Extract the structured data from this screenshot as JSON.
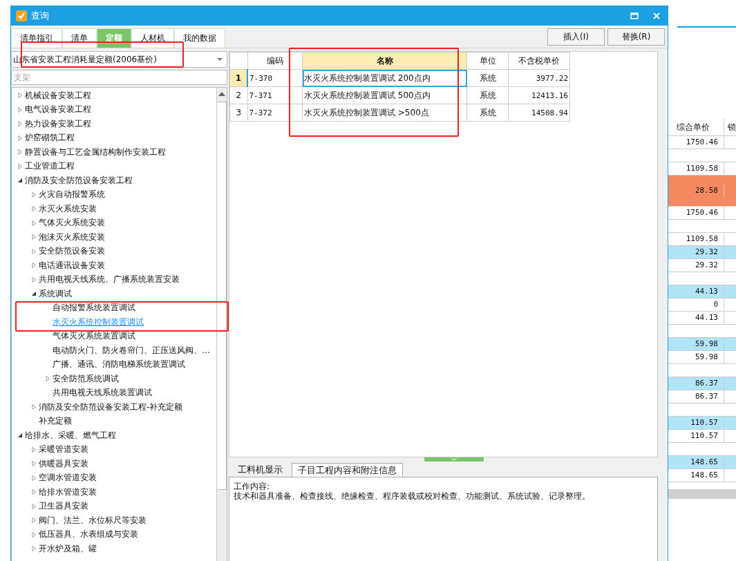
{
  "window": {
    "title": "查询"
  },
  "tabs": [
    {
      "label": "清单指引",
      "selected": false
    },
    {
      "label": "清单",
      "selected": false
    },
    {
      "label": "定额",
      "selected": true
    },
    {
      "label": "人材机",
      "selected": false
    },
    {
      "label": "我的数据",
      "selected": false
    }
  ],
  "buttons": [
    "插入(I)",
    "替换(R)"
  ],
  "library_select": {
    "value": "山东省安装工程消耗量定额(2006基价)"
  },
  "search": {
    "placeholder": "支架"
  },
  "tree": [
    {
      "label": "机械设备安装工程",
      "kind": "folder",
      "expanded": false,
      "selected": false
    },
    {
      "label": "电气设备安装工程",
      "kind": "folder",
      "expanded": false,
      "selected": false
    },
    {
      "label": "热力设备安装工程",
      "kind": "folder",
      "expanded": false,
      "selected": false
    },
    {
      "label": "炉窑砌筑工程",
      "kind": "folder",
      "expanded": false,
      "selected": false
    },
    {
      "label": "静置设备与工艺金属结构制作安装工程",
      "kind": "folder",
      "expanded": false,
      "selected": false
    },
    {
      "label": "工业管道工程",
      "kind": "folder",
      "expanded": false,
      "selected": false
    },
    {
      "label": "消防及安全防范设备安装工程",
      "kind": "folder",
      "expanded": true,
      "selected": false,
      "children": [
        {
          "label": "火灾自动报警系统",
          "kind": "folder",
          "expanded": false,
          "selected": false
        },
        {
          "label": "水灭火系统安装",
          "kind": "folder",
          "expanded": false,
          "selected": false
        },
        {
          "label": "气体灭火系统安装",
          "kind": "folder",
          "expanded": false,
          "selected": false
        },
        {
          "label": "泡沫灭火系统安装",
          "kind": "folder",
          "expanded": false,
          "selected": false
        },
        {
          "label": "安全防范设备安装",
          "kind": "folder",
          "expanded": false,
          "selected": false
        },
        {
          "label": "电话通讯设备安装",
          "kind": "folder",
          "expanded": false,
          "selected": false
        },
        {
          "label": "共用电视天线系统、广播系统装置安装",
          "kind": "folder",
          "expanded": false,
          "selected": false
        },
        {
          "label": "系统调试",
          "kind": "folder",
          "expanded": true,
          "selected": false,
          "children": [
            {
              "label": "自动报警系统装置调试",
              "kind": "leaf",
              "selected": false
            },
            {
              "label": "水灭火系统控制装置调试",
              "kind": "leaf",
              "selected": true
            },
            {
              "label": "气体灭火系统装置调试",
              "kind": "leaf",
              "selected": false
            },
            {
              "label": "电动防火门、防火卷帘门、正压送风阀、…",
              "kind": "leaf",
              "selected": false
            },
            {
              "label": "广播、通讯、消防电梯系统装置调试",
              "kind": "leaf",
              "selected": false
            },
            {
              "label": "安全防范系统调试",
              "kind": "folder",
              "expanded": false,
              "selected": false
            },
            {
              "label": "共用电视天线系统装置调试",
              "kind": "leaf",
              "selected": false
            }
          ]
        },
        {
          "label": "消防及安全防范设备安装工程-补充定额",
          "kind": "folder",
          "expanded": false,
          "selected": false
        },
        {
          "label": "补充定额",
          "kind": "leaf",
          "selected": false
        }
      ]
    },
    {
      "label": "给排水、采暖、燃气工程",
      "kind": "folder",
      "expanded": true,
      "selected": false,
      "children": [
        {
          "label": "采暖管道安装",
          "kind": "folder",
          "expanded": false,
          "selected": false
        },
        {
          "label": "供暖器具安装",
          "kind": "folder",
          "expanded": false,
          "selected": false
        },
        {
          "label": "空调水管道安装",
          "kind": "folder",
          "expanded": false,
          "selected": false
        },
        {
          "label": "给排水管道安装",
          "kind": "folder",
          "expanded": false,
          "selected": false
        },
        {
          "label": "卫生器具安装",
          "kind": "folder",
          "expanded": false,
          "selected": false
        },
        {
          "label": "阀门、法兰、水位标尺等安装",
          "kind": "folder",
          "expanded": false,
          "selected": false
        },
        {
          "label": "低压器具、水表组成与安装",
          "kind": "folder",
          "expanded": false,
          "selected": false
        },
        {
          "label": "开水炉及箱、罐",
          "kind": "folder",
          "expanded": false,
          "selected": false
        }
      ]
    }
  ],
  "table": {
    "columns": [
      "编码",
      "名称",
      "单位",
      "不含税单价"
    ],
    "rows": [
      {
        "num": "1",
        "code": "7-370",
        "name": "水灭火系统控制装置调试 200点内",
        "unit": "系统",
        "price": "3977.22",
        "selected": true
      },
      {
        "num": "2",
        "code": "7-371",
        "name": "水灭火系统控制装置调试 500点内",
        "unit": "系统",
        "price": "12413.16",
        "selected": false
      },
      {
        "num": "3",
        "code": "7-372",
        "name": "水灭火系统控制装置调试 >500点",
        "unit": "系统",
        "price": "14508.94",
        "selected": false
      }
    ]
  },
  "bottom_tabs": [
    {
      "label": "工料机显示",
      "selected": false
    },
    {
      "label": "子目工程内容和附注信息",
      "selected": true
    }
  ],
  "work_content": {
    "heading": "工作内容:",
    "text": "技术和器具准备、检查接线、绝缘检查、程序装载或校对检查、功能测试、系统试验、记录整理。"
  },
  "background_grid": {
    "columns": [
      "综合单价",
      "锁"
    ],
    "rows": [
      {
        "kind": "detail",
        "value": "1750.46"
      },
      {
        "kind": "empty"
      },
      {
        "kind": "detail",
        "value": "1109.58"
      },
      {
        "kind": "current",
        "value": "28.58"
      },
      {
        "kind": "detail",
        "value": "1750.46"
      },
      {
        "kind": "empty"
      },
      {
        "kind": "detail",
        "value": "1109.58"
      },
      {
        "kind": "group",
        "value": "29.32"
      },
      {
        "kind": "detail",
        "value": "29.32"
      },
      {
        "kind": "empty"
      },
      {
        "kind": "group",
        "value": "44.13"
      },
      {
        "kind": "detail",
        "value": "0"
      },
      {
        "kind": "detail",
        "value": "44.13"
      },
      {
        "kind": "empty"
      },
      {
        "kind": "group",
        "value": "59.98"
      },
      {
        "kind": "detail",
        "value": "59.98"
      },
      {
        "kind": "empty"
      },
      {
        "kind": "group",
        "value": "86.37"
      },
      {
        "kind": "detail",
        "value": "86.37"
      },
      {
        "kind": "empty"
      },
      {
        "kind": "group",
        "value": "110.57"
      },
      {
        "kind": "detail",
        "value": "110.57"
      },
      {
        "kind": "empty"
      },
      {
        "kind": "group",
        "value": "148.65"
      },
      {
        "kind": "detail",
        "value": "148.65"
      }
    ]
  }
}
